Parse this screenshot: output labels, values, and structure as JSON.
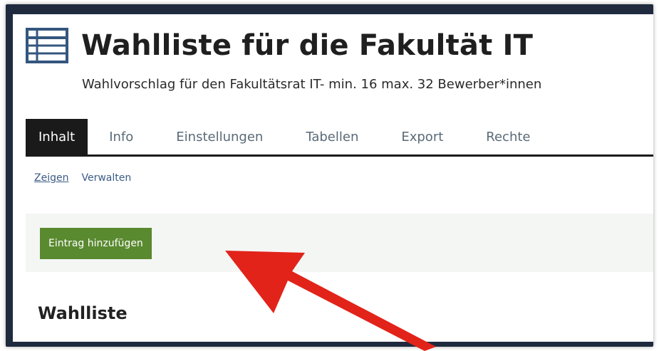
{
  "header": {
    "title": "Wahlliste für die Fakultät IT",
    "subtitle": "Wahlvorschlag für den Fakultätsrat IT- min. 16 max. 32 Bewerber*innen",
    "icon": "table-list-icon"
  },
  "tabs": [
    {
      "label": "Inhalt",
      "active": true
    },
    {
      "label": "Info",
      "active": false
    },
    {
      "label": "Einstellungen",
      "active": false
    },
    {
      "label": "Tabellen",
      "active": false
    },
    {
      "label": "Export",
      "active": false
    },
    {
      "label": "Rechte",
      "active": false
    }
  ],
  "subnav": {
    "show": "Zeigen",
    "manage": "Verwalten"
  },
  "toolbar": {
    "add_entry": "Eintrag hinzufügen"
  },
  "section": {
    "heading": "Wahlliste"
  },
  "colors": {
    "frame": "#1f2a3e",
    "button": "#5a8a30",
    "arrow": "#e2231a",
    "active_tab": "#1a1a1a"
  }
}
